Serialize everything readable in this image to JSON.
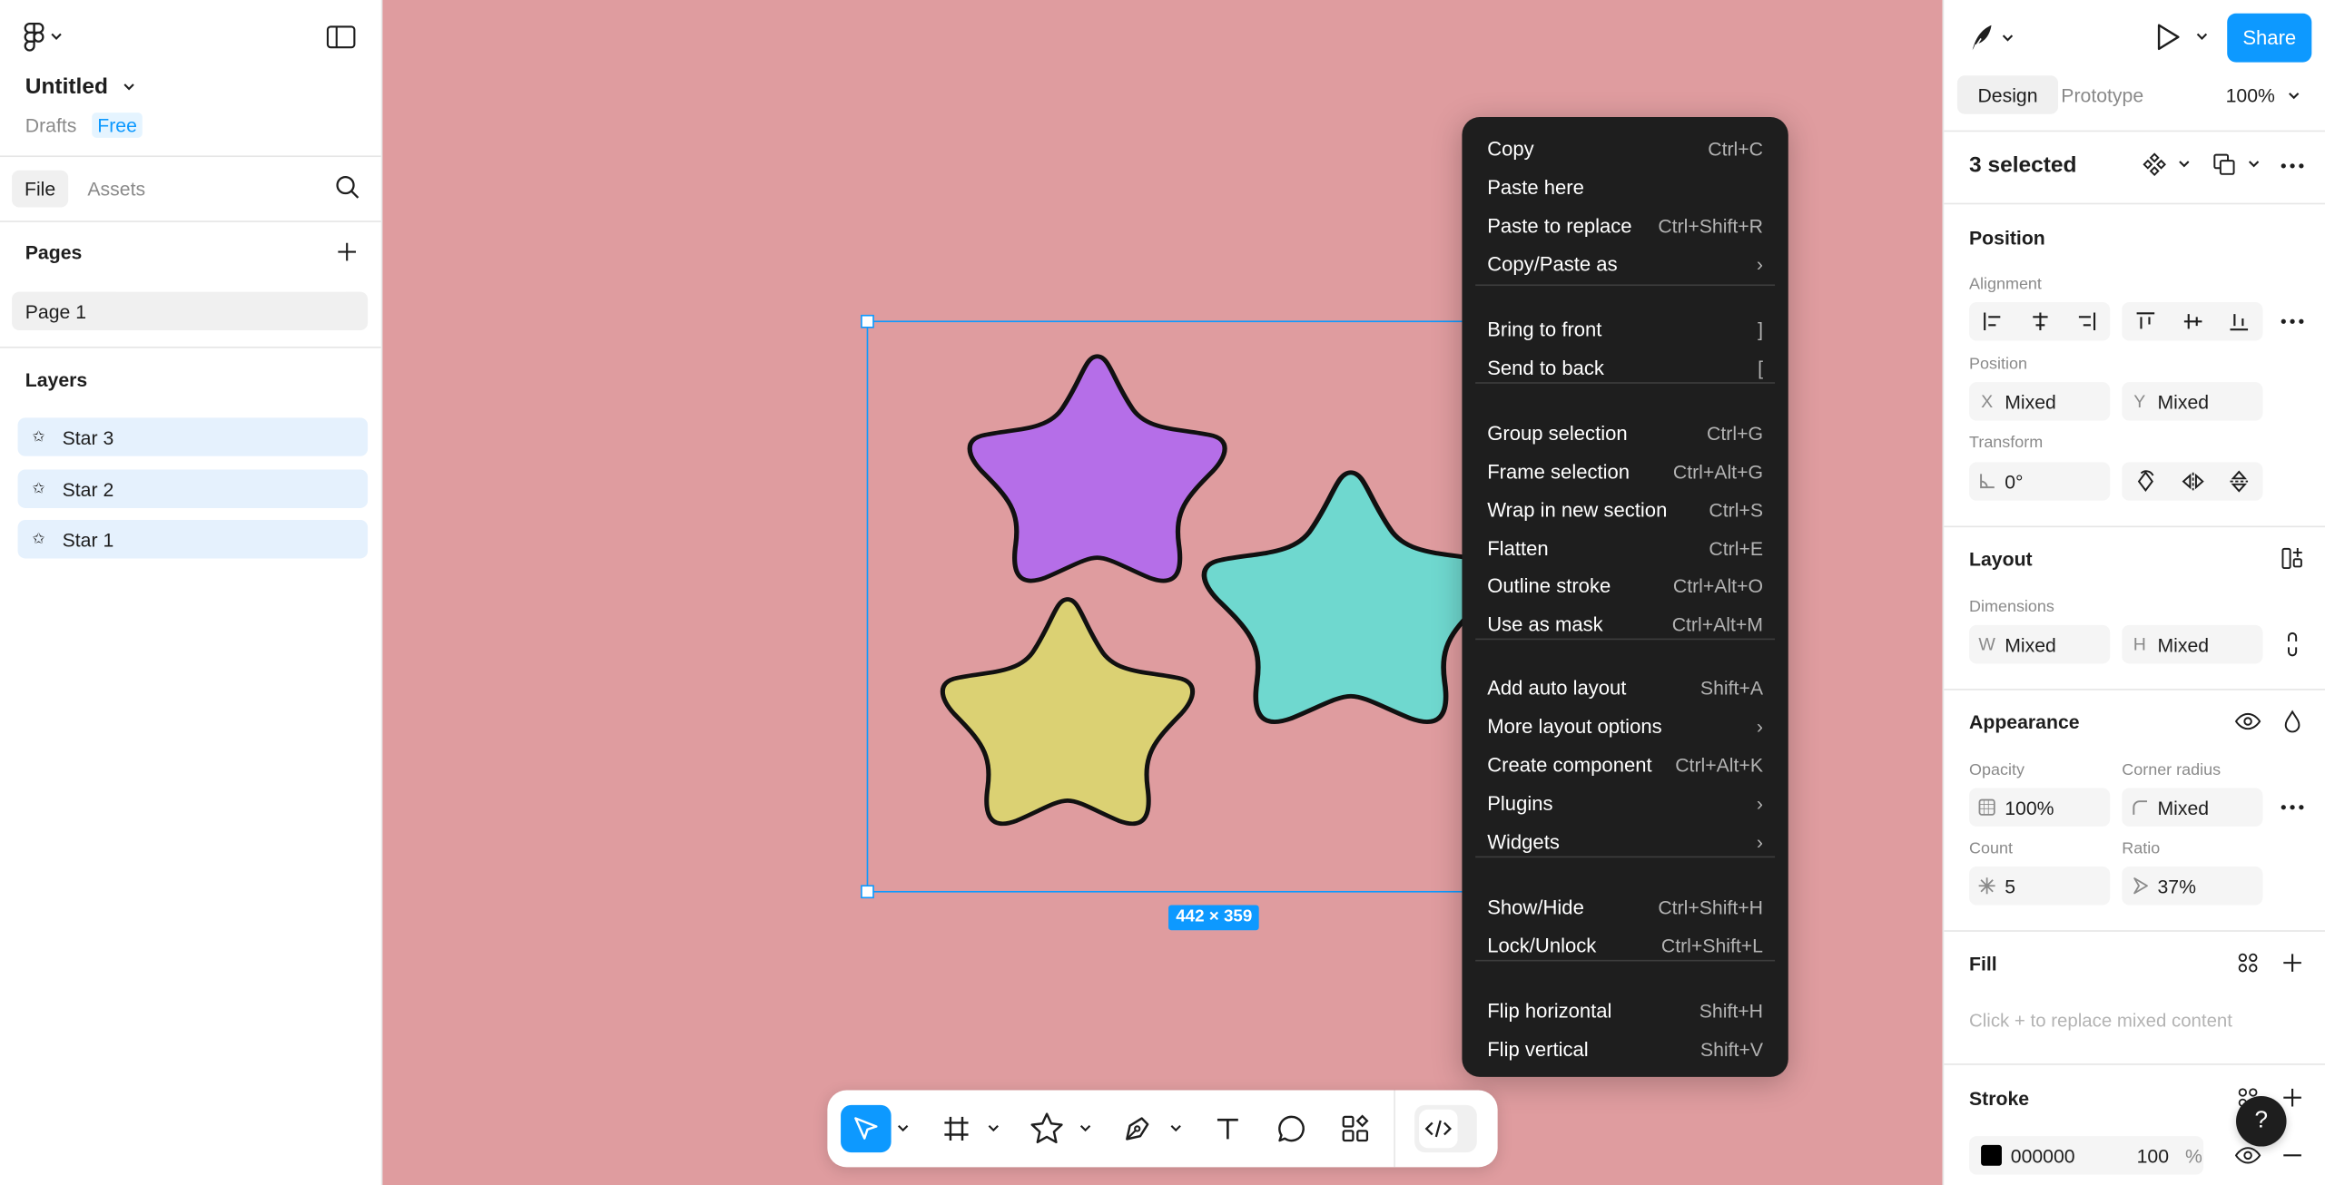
{
  "file": {
    "title": "Untitled",
    "location": "Drafts",
    "plan_badge": "Free"
  },
  "left_tabs": [
    "File",
    "Assets"
  ],
  "pages": {
    "header": "Pages",
    "items": [
      "Page 1"
    ]
  },
  "layers": {
    "header": "Layers",
    "items": [
      "Star 3",
      "Star 2",
      "Star 1"
    ]
  },
  "canvas": {
    "size_badge": "442 × 359",
    "background": "#df9c9f",
    "star_colors": [
      "#b56ee8",
      "#6fd8cf",
      "#dbd173"
    ]
  },
  "context_menu": {
    "groups": [
      [
        {
          "label": "Copy",
          "shortcut": "Ctrl+C"
        },
        {
          "label": "Paste here",
          "shortcut": ""
        },
        {
          "label": "Paste to replace",
          "shortcut": "Ctrl+Shift+R"
        },
        {
          "label": "Copy/Paste as",
          "shortcut": "›"
        }
      ],
      [
        {
          "label": "Bring to front",
          "shortcut": "]"
        },
        {
          "label": "Send to back",
          "shortcut": "["
        }
      ],
      [
        {
          "label": "Group selection",
          "shortcut": "Ctrl+G"
        },
        {
          "label": "Frame selection",
          "shortcut": "Ctrl+Alt+G"
        },
        {
          "label": "Wrap in new section",
          "shortcut": "Ctrl+S"
        },
        {
          "label": "Flatten",
          "shortcut": "Ctrl+E"
        },
        {
          "label": "Outline stroke",
          "shortcut": "Ctrl+Alt+O"
        },
        {
          "label": "Use as mask",
          "shortcut": "Ctrl+Alt+M"
        }
      ],
      [
        {
          "label": "Add auto layout",
          "shortcut": "Shift+A"
        },
        {
          "label": "More layout options",
          "shortcut": "›"
        },
        {
          "label": "Create component",
          "shortcut": "Ctrl+Alt+K"
        },
        {
          "label": "Plugins",
          "shortcut": "›"
        },
        {
          "label": "Widgets",
          "shortcut": "›"
        }
      ],
      [
        {
          "label": "Show/Hide",
          "shortcut": "Ctrl+Shift+H"
        },
        {
          "label": "Lock/Unlock",
          "shortcut": "Ctrl+Shift+L"
        }
      ],
      [
        {
          "label": "Flip horizontal",
          "shortcut": "Shift+H"
        },
        {
          "label": "Flip vertical",
          "shortcut": "Shift+V"
        }
      ]
    ]
  },
  "header": {
    "share_label": "Share",
    "accent": "#0d99ff"
  },
  "right_tabs": {
    "design": "Design",
    "prototype": "Prototype",
    "zoom": "100%"
  },
  "selection": {
    "label": "3 selected"
  },
  "position": {
    "title": "Position",
    "alignment_label": "Alignment",
    "position_label": "Position",
    "x_prefix": "X",
    "x_value": "Mixed",
    "y_prefix": "Y",
    "y_value": "Mixed",
    "transform_label": "Transform",
    "rotation": "0°"
  },
  "layout": {
    "title": "Layout",
    "dimensions_label": "Dimensions",
    "w_prefix": "W",
    "w_value": "Mixed",
    "h_prefix": "H",
    "h_value": "Mixed"
  },
  "appearance": {
    "title": "Appearance",
    "opacity_label": "Opacity",
    "opacity": "100%",
    "corner_label": "Corner radius",
    "corner": "Mixed",
    "count_label": "Count",
    "count": "5",
    "ratio_label": "Ratio",
    "ratio": "37%"
  },
  "fill": {
    "title": "Fill",
    "placeholder": "Click + to replace mixed content"
  },
  "stroke": {
    "title": "Stroke",
    "color": "000000",
    "opacity": "100",
    "unit": "%"
  },
  "help": {
    "label": "?"
  }
}
